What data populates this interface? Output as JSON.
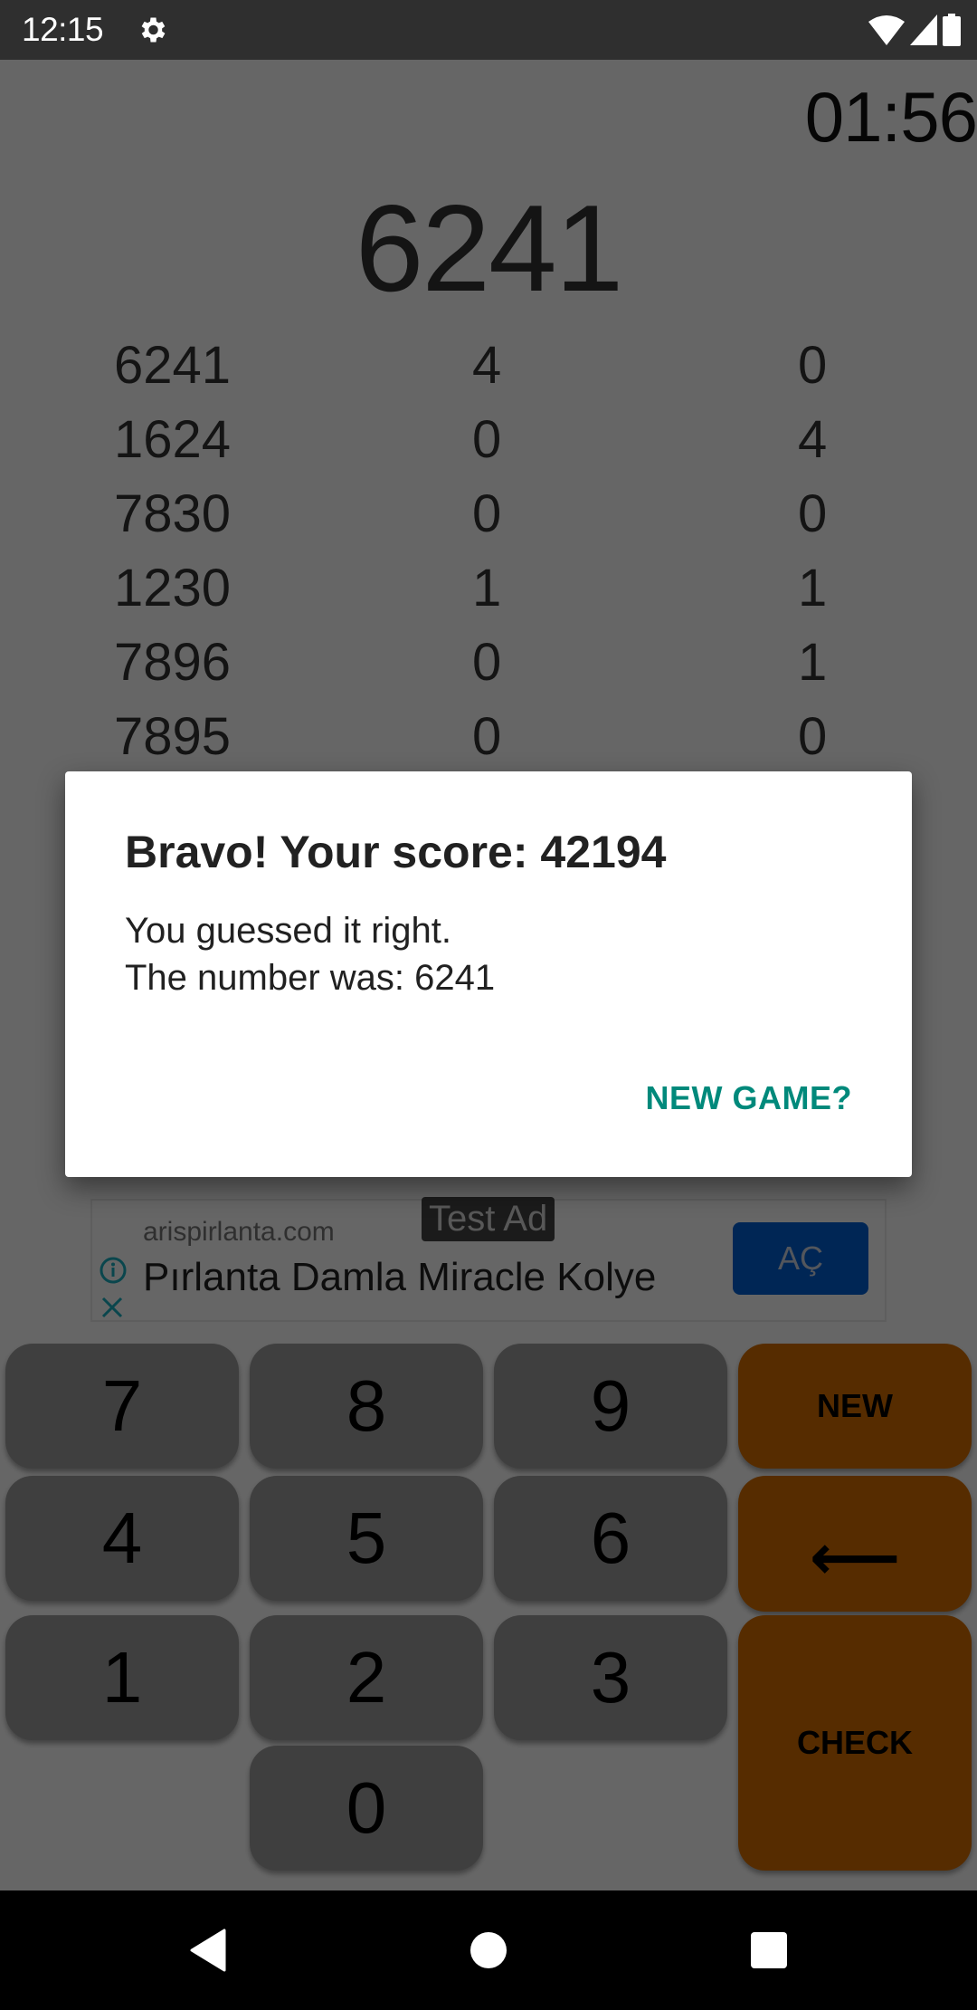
{
  "status_bar": {
    "time": "12:15",
    "icons": [
      "settings-gear-icon",
      "wifi-icon",
      "cell-signal-icon",
      "battery-icon"
    ]
  },
  "game": {
    "timer": "01:56",
    "secret_number": "6241",
    "history": [
      {
        "guess": "6241",
        "bulls": "4",
        "cows": "0"
      },
      {
        "guess": "1624",
        "bulls": "0",
        "cows": "4"
      },
      {
        "guess": "7830",
        "bulls": "0",
        "cows": "0"
      },
      {
        "guess": "1230",
        "bulls": "1",
        "cows": "1"
      },
      {
        "guess": "7896",
        "bulls": "0",
        "cows": "1"
      },
      {
        "guess": "7895",
        "bulls": "0",
        "cows": "0"
      }
    ]
  },
  "dialog": {
    "title": "Bravo! Your score: 42194",
    "body": "You guessed it right.\nThe number was: 6241",
    "button": "NEW GAME?",
    "button_color": "#00897b"
  },
  "ad": {
    "badge": "Test Ad",
    "domain": "arispirlanta.com",
    "title": "Pırlanta Damla Miracle Kolye",
    "cta": "AÇ",
    "cta_color": "#0060d4"
  },
  "keypad": {
    "digits": [
      "7",
      "8",
      "9",
      "4",
      "5",
      "6",
      "1",
      "2",
      "3",
      "0"
    ],
    "new_label": "NEW",
    "backspace_label": "⟵",
    "check_label": "CHECK",
    "digit_color": "#9e9e9e",
    "action_color": "#d86f00"
  },
  "nav_bar": {
    "buttons": [
      "back-icon",
      "home-icon",
      "recents-icon"
    ]
  }
}
